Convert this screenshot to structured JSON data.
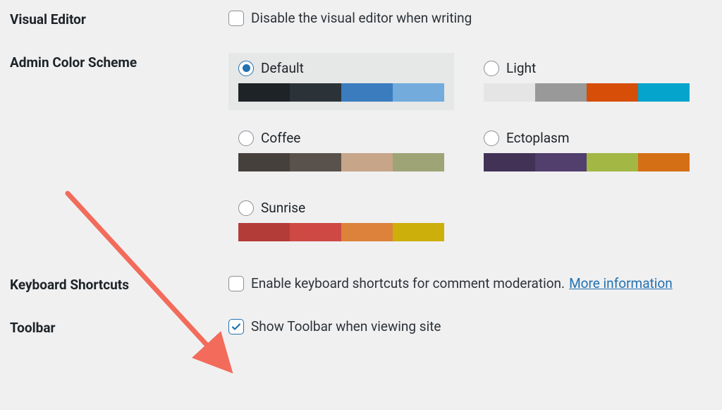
{
  "visual_editor": {
    "label": "Visual Editor",
    "checkbox_label": "Disable the visual editor when writing",
    "checked": false
  },
  "admin_color_scheme": {
    "label": "Admin Color Scheme",
    "selected_index": 0,
    "schemes": [
      {
        "name": "Default",
        "colors": [
          "#1d2327",
          "#2c3338",
          "#3a7cbe",
          "#72abdc"
        ]
      },
      {
        "name": "Light",
        "colors": [
          "#e5e5e5",
          "#999999",
          "#d64e07",
          "#04a4cc"
        ]
      },
      {
        "name": "Coffee",
        "colors": [
          "#46403c",
          "#59524c",
          "#c7a589",
          "#9ea476"
        ]
      },
      {
        "name": "Ectoplasm",
        "colors": [
          "#413256",
          "#523f6d",
          "#a3b745",
          "#d46f15"
        ]
      },
      {
        "name": "Sunrise",
        "colors": [
          "#b43c38",
          "#cf4944",
          "#dd823b",
          "#ccaf0b"
        ]
      }
    ]
  },
  "keyboard_shortcuts": {
    "label": "Keyboard Shortcuts",
    "checkbox_label": "Enable keyboard shortcuts for comment moderation.",
    "checked": false,
    "link_text": "More information"
  },
  "toolbar": {
    "label": "Toolbar",
    "checkbox_label": "Show Toolbar when viewing site",
    "checked": true
  },
  "annotation": {
    "arrow_color": "#f26b5b"
  }
}
